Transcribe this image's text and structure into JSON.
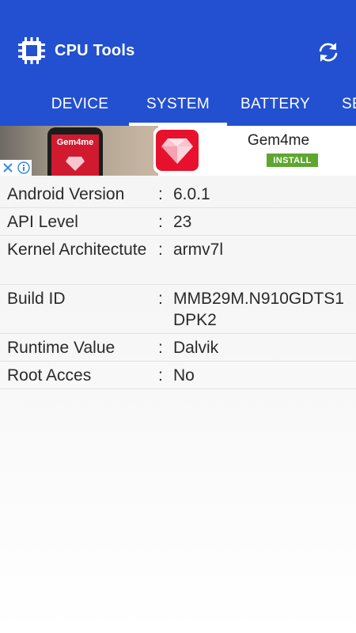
{
  "app": {
    "title": "CPU Tools"
  },
  "tabs": [
    {
      "label": "DEVICE",
      "active": false
    },
    {
      "label": "SYSTEM",
      "active": true
    },
    {
      "label": "BATTERY",
      "active": false
    },
    {
      "label": "SE",
      "active": false
    }
  ],
  "ad": {
    "app_name": "Gem4me",
    "install_label": "INSTALL",
    "phone_text": "Gem4me",
    "badges": [
      "close-icon",
      "info-icon"
    ]
  },
  "separator": ":",
  "system_info": [
    {
      "label": "Android Version",
      "value": "6.0.1"
    },
    {
      "label": "API Level",
      "value": "23"
    },
    {
      "label": "Kernel Architectute",
      "value": "armv7l"
    },
    {
      "label": "Build ID",
      "value": "MMB29M.N910GDTS1DPK2"
    },
    {
      "label": "Runtime Value",
      "value": "Dalvik"
    },
    {
      "label": "Root Acces",
      "value": "No"
    }
  ],
  "colors": {
    "app_bar": "#2250d0",
    "tab_indicator": "#ffffff",
    "install_button": "#5fa630",
    "ad_logo": "#e8112d"
  }
}
